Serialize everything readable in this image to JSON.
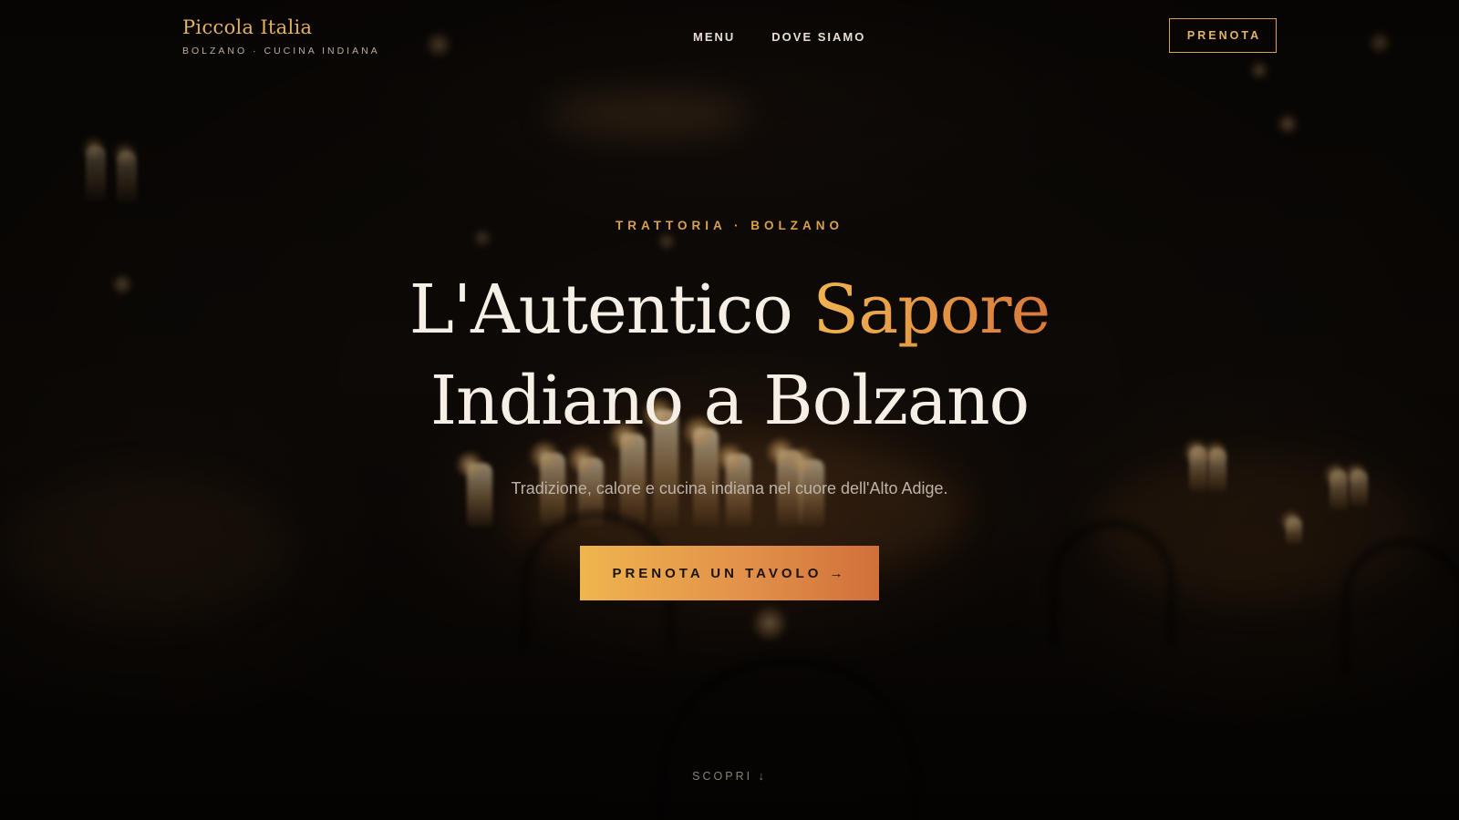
{
  "header": {
    "brand_name": "Piccola Italia",
    "brand_tagline": "BOLZANO · CUCINA INDIANA",
    "nav": [
      {
        "label": "MENU"
      },
      {
        "label": "DOVE SIAMO"
      }
    ],
    "reserve_label": "PRENOTA"
  },
  "hero": {
    "eyebrow": "TRATTORIA · BOLZANO",
    "headline_part1": "L'Autentico ",
    "headline_accent": "Sapore",
    "headline_line2": "Indiano a Bolzano",
    "subtitle": "Tradizione, calore e cucina indiana nel cuore dell'Alto Adige.",
    "cta_label": "PRENOTA UN TAVOLO →",
    "scroll_hint": "SCOPRI ↓"
  },
  "colors": {
    "accent_gold": "#e3b25c",
    "accent_orange": "#d9783a",
    "background": "#0b0806"
  }
}
